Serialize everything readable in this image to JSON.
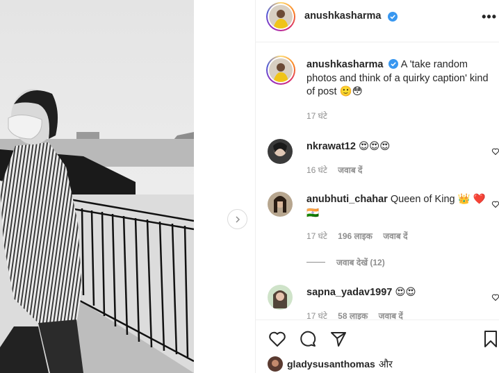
{
  "post": {
    "author": "anushkasharma",
    "author_verified": true,
    "caption": "A 'take random photos and think of a quirky caption' kind of post 🙂😳",
    "caption_time": "17 घंटे"
  },
  "header": {
    "username": "anushkasharma",
    "more_label": "•••"
  },
  "icons": {
    "verified": "verified-badge-icon",
    "like": "heart-icon",
    "comment": "comment-bubble-icon",
    "share": "paper-plane-icon",
    "save": "bookmark-icon",
    "next": "chevron-right-icon"
  },
  "comments": [
    {
      "username": "nkrawat12",
      "text": "😍😍😍",
      "time": "16 घंटे",
      "likes": "",
      "reply_label": "जवाब दें"
    },
    {
      "username": "anubhuti_chahar",
      "text": "Queen of King 👑 ❤️🇮🇳",
      "time": "17 घंटे",
      "likes": "196 लाइक",
      "reply_label": "जवाब दें"
    },
    {
      "username": "sapna_yadav1997",
      "text": "😍😍",
      "time": "17 घंटे",
      "likes": "58 लाइक",
      "reply_label": "जवाब दें"
    }
  ],
  "view_replies": "जवाब देखें (12)",
  "liked_by": {
    "username": "gladysusanthomas",
    "suffix": "और"
  },
  "colors": {
    "accent_verified": "#3897f0",
    "text": "#262626",
    "secondary": "#8e8e8e",
    "border": "#efefef"
  }
}
